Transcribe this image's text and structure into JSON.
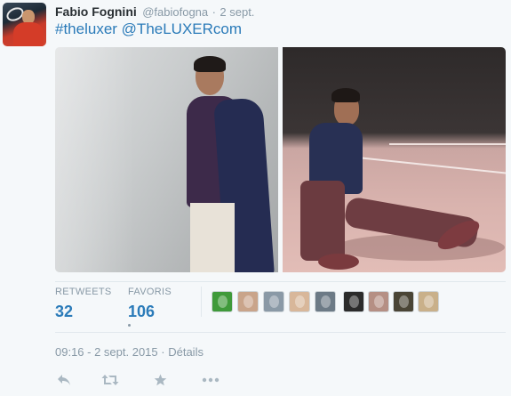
{
  "tweet": {
    "author": {
      "fullname": "Fabio Fognini",
      "username": "@fabiofogna",
      "separator": "·",
      "date": "2 sept."
    },
    "text": {
      "hashtag": "#theluxer",
      "mention": "@TheLUXERcom",
      "space": " "
    },
    "photos": [
      {
        "icon": "photo-man-leaning-wall"
      },
      {
        "icon": "photo-man-sitting-court"
      }
    ],
    "stats": {
      "retweets_label": "RETWEETS",
      "retweets_value": "32",
      "favorites_label": "FAVORIS",
      "favorites_value": "106"
    },
    "favoriter_avatars": [
      {
        "color": "#3f9a3a"
      },
      {
        "color": "#c9a48a"
      },
      {
        "color": "#8a99a6"
      },
      {
        "color": "#d8b79a"
      },
      {
        "color": "#6c7a86"
      },
      {
        "color": "#2b2b2b"
      },
      {
        "color": "#b58f84"
      },
      {
        "color": "#4a4536"
      },
      {
        "color": "#c9b08a"
      }
    ],
    "timestamp": {
      "time": "09:16 - 2 sept. 2015",
      "separator": " · ",
      "details": "Détails"
    },
    "actions": {
      "reply": "reply-icon",
      "retweet": "retweet-icon",
      "favorite": "star-icon",
      "more": "more-icon"
    },
    "colors": {
      "link": "#2b7bb9",
      "muted": "#8899a6",
      "background": "#f5f8fa",
      "action_icon": "#aab8c2"
    }
  }
}
